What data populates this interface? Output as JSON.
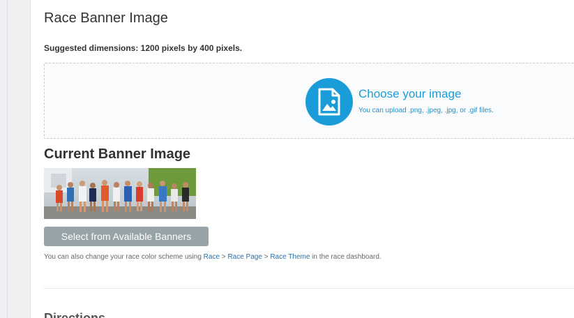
{
  "section": {
    "title": "Race Banner Image",
    "hint": "Suggested dimensions: 1200 pixels by 400 pixels."
  },
  "upload": {
    "icon": "image-file-icon",
    "title": "Choose your image",
    "subtitle": "You can upload .png, .jpeg, .jpg, or .gif files.",
    "accent_color": "#1a9cd8"
  },
  "current": {
    "title": "Current Banner Image",
    "thumbnail": "race-runners-photo"
  },
  "select_button": {
    "label": "Select from Available Banners",
    "color": "#96a3a7"
  },
  "note": {
    "prefix": "You can also change your race color scheme using ",
    "link1": "Race",
    "sep1": " > ",
    "link2": "Race Page",
    "sep2": " > ",
    "link3": "Race Theme",
    "suffix": " in the race dashboard."
  },
  "next_section": {
    "title": "Directions"
  }
}
